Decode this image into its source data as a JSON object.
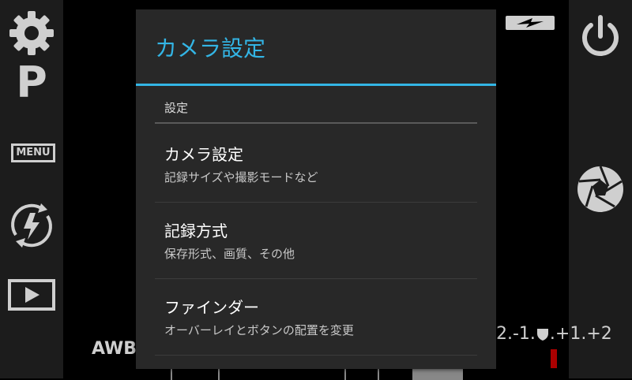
{
  "camera": {
    "mode_letter": "P",
    "menu_label": "MENU",
    "awb_label": "AWB",
    "ev_scale": {
      "left": "2.-1.",
      "right": ".+1.+2"
    },
    "icons": {
      "settings": "gear-icon",
      "flash_auto": "flash-auto-icon",
      "playback": "play-icon",
      "battery": "battery-icon",
      "power": "power-icon",
      "shutter": "shutter-icon",
      "ev_indicator": "shield-icon"
    }
  },
  "dialog": {
    "title": "カメラ設定",
    "section_header": "設定",
    "items": [
      {
        "title": "カメラ設定",
        "summary": "記録サイズや撮影モードなど"
      },
      {
        "title": "記録方式",
        "summary": "保存形式、画質、その他"
      },
      {
        "title": "ファインダー",
        "summary": "オーバーレイとボタンの配置を変更"
      }
    ]
  },
  "colors": {
    "accent": "#33b5e5",
    "dialog_bg": "#282828",
    "ev_marker": "#aa0000"
  }
}
